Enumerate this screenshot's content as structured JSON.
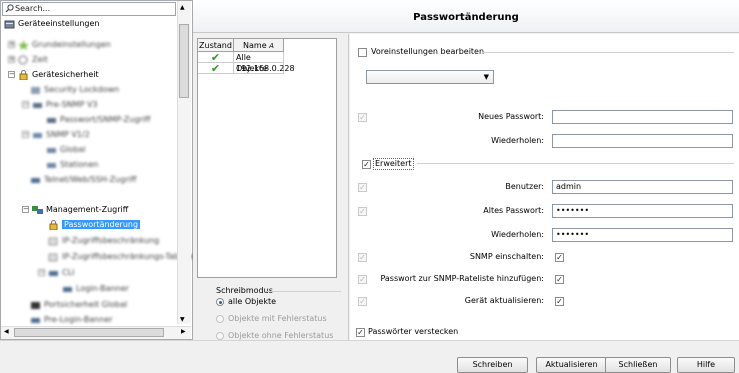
{
  "search": {
    "placeholder": "Search..."
  },
  "tree": {
    "root": "Geräteeinstellungen",
    "items": [
      {
        "label": "Grundeinstellungen"
      },
      {
        "label": "Zeit"
      },
      {
        "label": "Gerätesicherheit"
      },
      {
        "label": "Security Lockdown"
      },
      {
        "label": "Pre-SNMP V3"
      },
      {
        "label": "Passwort/SNMP-Zugriff"
      },
      {
        "label": "SNMP V1/2"
      },
      {
        "label": "Global"
      },
      {
        "label": "Stationen"
      },
      {
        "label": "Telnet/Web/SSH-Zugriff"
      },
      {
        "label": "Management-Zugriff"
      },
      {
        "label": "Passwortänderung"
      },
      {
        "label": "IP-Zugriffsbeschränkung"
      },
      {
        "label": "IP-Zugriffsbeschränkungs-Tabelle"
      },
      {
        "label": "CLI"
      },
      {
        "label": "Login-Banner"
      },
      {
        "label": "Portsicherheit Global"
      },
      {
        "label": "Pre-Login-Banner"
      }
    ]
  },
  "header": {
    "title": "Passwortänderung"
  },
  "objects": {
    "columns": [
      "Zustand",
      "Name"
    ],
    "rows": [
      {
        "state": "✔",
        "name": "Alle Objekte"
      },
      {
        "state": "✔",
        "name": "192.168.0.228"
      }
    ]
  },
  "mode": {
    "title": "Schreibmodus",
    "options": [
      "alle Objekte",
      "Objekte mit Fehlerstatus",
      "Objekte ohne Fehlerstatus"
    ]
  },
  "form": {
    "presets_label": "Voreinstellungen bearbeiten",
    "new_password_label": "Neues Passwort:",
    "repeat_label": "Wiederholen:",
    "extended_label": "Erweitert",
    "user_label": "Benutzer:",
    "user_value": "admin",
    "old_password_label": "Altes Passwort:",
    "old_password_value": "•••••••",
    "repeat2_label": "Wiederholen:",
    "repeat2_value": "•••••••",
    "snmp_enable_label": "SNMP einschalten:",
    "snmp_rate_label": "Passwort zur SNMP-Rateliste hinzufügen:",
    "update_device_label": "Gerät aktualisieren:",
    "hide_passwords_label": "Passwörter verstecken"
  },
  "buttons": {
    "write": "Schreiben",
    "refresh": "Aktualisieren",
    "close": "Schließen",
    "help": "Hilfe"
  },
  "colors": {
    "selection": "#3399ff",
    "checkmark": "#2a9a1e"
  }
}
